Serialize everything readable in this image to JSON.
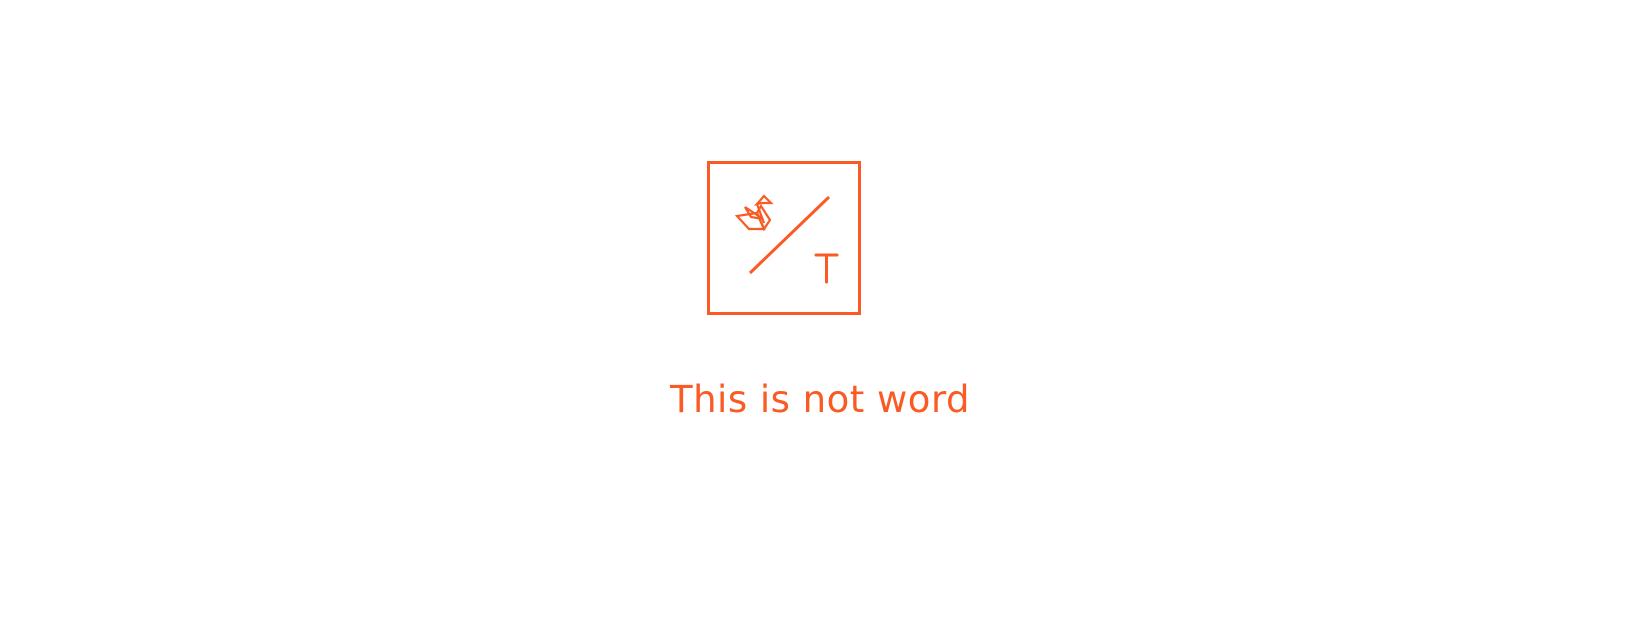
{
  "brand": {
    "color": "#FA5A23",
    "logo_icon": "swan-slash-t-logo",
    "logo_letter": "T"
  },
  "message": "This is not word"
}
